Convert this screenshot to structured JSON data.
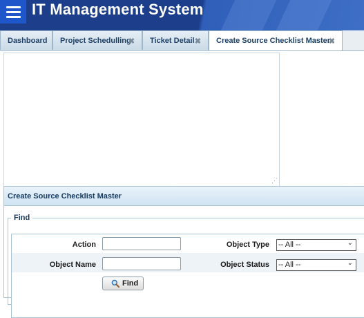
{
  "app": {
    "title": "IT Management System"
  },
  "tabs": [
    {
      "label": "Dashboard",
      "closable": false,
      "active": false
    },
    {
      "label": "Project Schedulling",
      "closable": true,
      "active": false
    },
    {
      "label": "Ticket Detail",
      "closable": true,
      "active": false
    },
    {
      "label": "Create Source Checklist Master",
      "closable": true,
      "active": true
    }
  ],
  "tab_close_glyph": "✖",
  "panel": {
    "title": "Create Source Checklist Master"
  },
  "find": {
    "legend": "Find",
    "action_label": "Action",
    "action_value": "",
    "object_name_label": "Object Name",
    "object_name_value": "",
    "object_type_label": "Object Type",
    "object_type_value": "-- All --",
    "object_status_label": "Object Status",
    "object_status_value": "-- All --",
    "find_button": "Find"
  },
  "colors": {
    "header_bg": "#1d3e8a",
    "menu_button": "#1f56c9",
    "tab_text": "#1c3f66",
    "panel_header": "#cfe3f1"
  },
  "icons": [
    "menu-icon",
    "close-icon",
    "magnifier-icon",
    "resize-grip-icon",
    "chevron-down-icon"
  ]
}
